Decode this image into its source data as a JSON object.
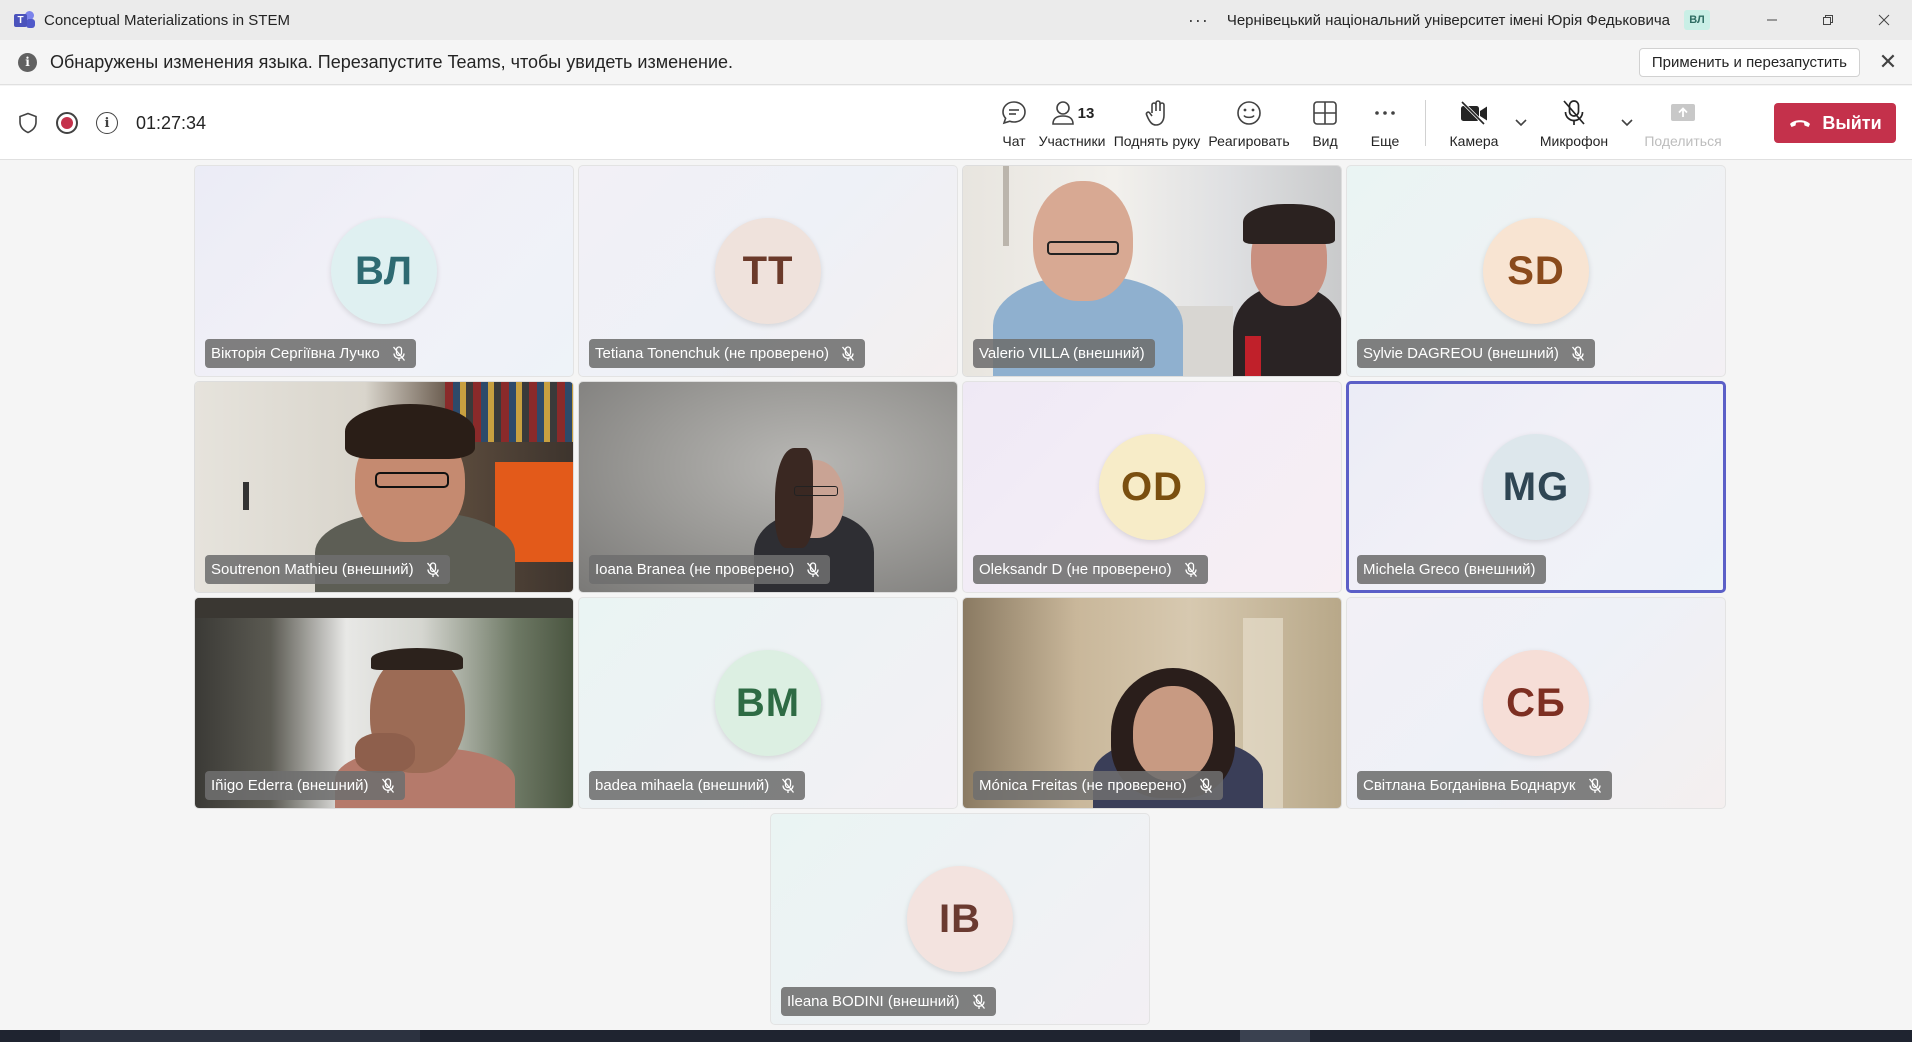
{
  "window": {
    "title": "Conceptual Materializations in STEM",
    "more_label": "···",
    "org_name": "Чернівецький національний університет імені Юрія Федьковича",
    "org_avatar": "ВЛ",
    "logo_letter": "T"
  },
  "notice": {
    "icon_label": "i",
    "text": "Обнаружены изменения языка. Перезапустите Teams, чтобы увидеть изменение.",
    "apply_label": "Применить и перезапустить",
    "close_label": "✕"
  },
  "toolbar": {
    "info_label": "i",
    "timer": "01:27:34",
    "chat_label": "Чат",
    "participants_label": "Участники",
    "participants_count": "13",
    "raise_hand_label": "Поднять руку",
    "react_label": "Реагировать",
    "view_label": "Вид",
    "more_label": "Еще",
    "camera_label": "Камера",
    "mic_label": "Микрофон",
    "share_label": "Поделиться",
    "leave_label": "Выйти"
  },
  "participants": [
    {
      "name": "Вікторія Сергіївна Лучко",
      "initials": "ВЛ",
      "video": false,
      "avatar_bg": "#dff0f1",
      "avatar_fg": "#2e6a72"
    },
    {
      "name": "Tetiana Tonenchuk (не проверено)",
      "initials": "TT",
      "video": false,
      "avatar_bg": "#efe2dc",
      "avatar_fg": "#6b3a2a"
    },
    {
      "name": "Valerio VILLA (внешний)",
      "initials": "",
      "video": true
    },
    {
      "name": "Sylvie DAGREOU (внешний)",
      "initials": "SD",
      "video": false,
      "avatar_bg": "#f8e4d2",
      "avatar_fg": "#8a4a1c"
    },
    {
      "name": "Soutrenon Mathieu (внешний)",
      "initials": "",
      "video": true
    },
    {
      "name": "Ioana Branea (не проверено)",
      "initials": "",
      "video": true
    },
    {
      "name": "Oleksandr D (не проверено)",
      "initials": "OD",
      "video": false,
      "avatar_bg": "#f7ecc8",
      "avatar_fg": "#7a4f10"
    },
    {
      "name": "Michela Greco (внешний)",
      "initials": "MG",
      "video": false,
      "avatar_bg": "#dde7ec",
      "avatar_fg": "#2f4654"
    },
    {
      "name": "Iñigo Ederra (внешний)",
      "initials": "",
      "video": true
    },
    {
      "name": "badea mihaela (внешний)",
      "initials": "BM",
      "video": false,
      "avatar_bg": "#dcefe2",
      "avatar_fg": "#2e6b44"
    },
    {
      "name": "Mónica Freitas (не проверено)",
      "initials": "",
      "video": true
    },
    {
      "name": "Світлана Богданівна Боднарук",
      "initials": "СБ",
      "video": false,
      "avatar_bg": "#f6ded7",
      "avatar_fg": "#7d2f22"
    },
    {
      "name": "Ileana BODINI (внешний)",
      "initials": "IB",
      "video": false,
      "avatar_bg": "#f3e3df",
      "avatar_fg": "#6a3a30"
    }
  ],
  "colors": {
    "accent": "#5b5fc7",
    "leave": "#c4314b",
    "recording": "#c4314b"
  }
}
